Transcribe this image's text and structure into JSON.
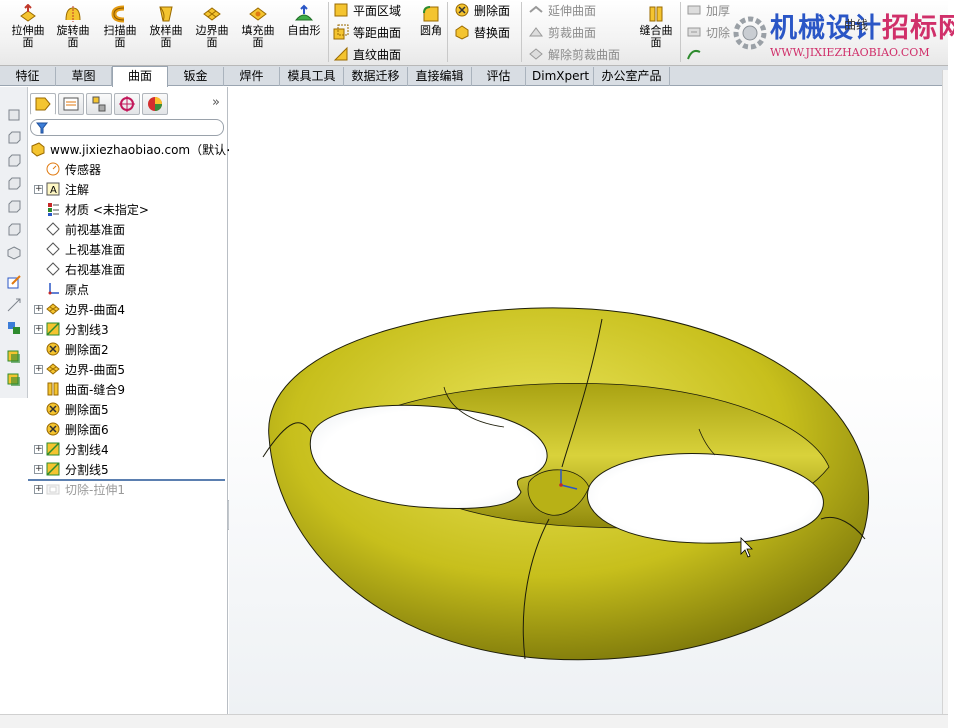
{
  "ribbon": {
    "buttons": [
      {
        "id": "extrude",
        "label": "拉伸曲面"
      },
      {
        "id": "revolve",
        "label": "旋转曲面"
      },
      {
        "id": "sweep",
        "label": "扫描曲面"
      },
      {
        "id": "loft",
        "label": "放样曲面"
      },
      {
        "id": "boundary",
        "label": "边界曲面"
      },
      {
        "id": "fill",
        "label": "填充曲面"
      },
      {
        "id": "freeform",
        "label": "自由形"
      }
    ],
    "small": {
      "planar": "平面区域",
      "offset": "等距曲面",
      "ruled": "直纹曲面",
      "fillet": "圆角",
      "delete_face": "删除面",
      "replace_face": "替换面",
      "extend": "延伸曲面",
      "trim": "剪裁曲面",
      "untrim": "解除剪裁曲面",
      "knit": "缝合曲面",
      "thicken": "加厚",
      "thicken_cut": "切除",
      "curves": "曲线"
    }
  },
  "watermark": {
    "title_a": "机械设计",
    "title_b": "招标网",
    "url": "WWW.JIXIEZHAOBIAO.COM"
  },
  "tabs": [
    "特征",
    "草图",
    "曲面",
    "钣金",
    "焊件",
    "模具工具",
    "数据迁移",
    "直接编辑",
    "评估",
    "DimXpert",
    "办公室产品"
  ],
  "active_tab": "曲面",
  "feature_manager": {
    "root": "www.jixiezhaobiao.com（默认<",
    "items": [
      {
        "label": "传感器",
        "expander": false,
        "icon": "sensor-icon"
      },
      {
        "label": "注解",
        "expander": true,
        "icon": "annotation-icon"
      },
      {
        "label": "材质 <未指定>",
        "expander": false,
        "icon": "material-icon"
      },
      {
        "label": "前视基准面",
        "expander": false,
        "icon": "plane-icon"
      },
      {
        "label": "上视基准面",
        "expander": false,
        "icon": "plane-icon"
      },
      {
        "label": "右视基准面",
        "expander": false,
        "icon": "plane-icon"
      },
      {
        "label": "原点",
        "expander": false,
        "icon": "origin-icon"
      },
      {
        "label": "边界-曲面4",
        "expander": true,
        "icon": "boundary-surface-icon"
      },
      {
        "label": "分割线3",
        "expander": true,
        "icon": "split-line-icon"
      },
      {
        "label": "删除面2",
        "expander": false,
        "icon": "delete-face-icon"
      },
      {
        "label": "边界-曲面5",
        "expander": true,
        "icon": "boundary-surface-icon"
      },
      {
        "label": "曲面-缝合9",
        "expander": false,
        "icon": "knit-surface-icon"
      },
      {
        "label": "删除面5",
        "expander": false,
        "icon": "delete-face-icon"
      },
      {
        "label": "删除面6",
        "expander": false,
        "icon": "delete-face-icon"
      },
      {
        "label": "分割线4",
        "expander": true,
        "icon": "split-line-icon"
      },
      {
        "label": "分割线5",
        "expander": true,
        "icon": "split-line-icon"
      },
      {
        "label": "切除-拉伸1",
        "expander": true,
        "icon": "cut-extrude-icon",
        "suppressed": true
      }
    ]
  },
  "colors": {
    "model_yellow": "#c8c01a",
    "model_shadow": "#6e6a08",
    "tab_bar": "#d8dde3",
    "watermark_blue": "#2a56c6",
    "watermark_red": "#d0306a"
  }
}
